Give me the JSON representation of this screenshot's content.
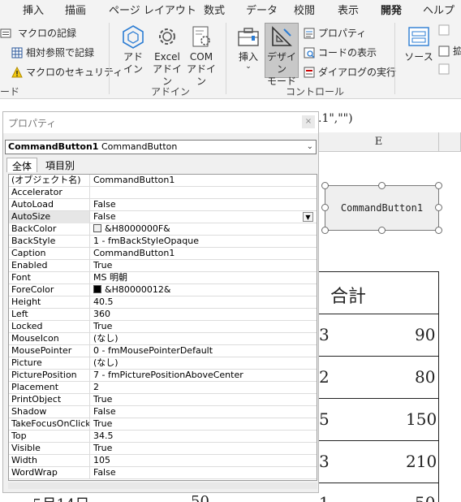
{
  "ribbon": {
    "tabs": [
      {
        "label": "挿入",
        "active": false
      },
      {
        "label": "描画",
        "active": false
      },
      {
        "label": "ページ レイアウト",
        "active": false
      },
      {
        "label": "数式",
        "active": false
      },
      {
        "label": "データ",
        "active": false
      },
      {
        "label": "校閲",
        "active": false
      },
      {
        "label": "表示",
        "active": false
      },
      {
        "label": "開発",
        "active": true
      },
      {
        "label": "ヘルプ",
        "active": false
      }
    ],
    "code_group": {
      "record_macro": "マクロの記録",
      "relative_ref": "相対参照で記録",
      "macro_security": "マクロのセキュリティ",
      "label_partial": "ード"
    },
    "addins_group": {
      "addins": "アド\nイン",
      "excel_addins": "Excel\nアドイン",
      "com_addins": "COM\nアドイン",
      "label": "アドイン"
    },
    "controls_group": {
      "insert": "挿入",
      "design_mode": "デザイン\nモード",
      "properties": "プロパティ",
      "view_code": "コードの表示",
      "run_dialog": "ダイアログの実行",
      "label": "コントロール"
    },
    "xml_group": {
      "source": "ソース",
      "extend_partial": "拡"
    }
  },
  "sheet": {
    "formula_partial": ".1\",\"\")",
    "column_e": "E",
    "header_total": "合計",
    "totals": [
      "90",
      "80",
      "150",
      "210",
      "50"
    ],
    "left_partial_digits": [
      "3",
      "2",
      "5",
      "3",
      "1"
    ],
    "bottom_partial_date": "5月14日",
    "bottom_partial_value": "50",
    "command_button_caption": "CommandButton1"
  },
  "properties": {
    "title": "プロパティ",
    "close": "×",
    "object_name": "CommandButton1",
    "object_type": "CommandButton",
    "tab_all": "全体",
    "tab_category": "項目別",
    "rows": [
      {
        "name": "(オブジェクト名)",
        "value": "CommandButton1"
      },
      {
        "name": "Accelerator",
        "value": ""
      },
      {
        "name": "AutoLoad",
        "value": "False"
      },
      {
        "name": "AutoSize",
        "value": "False"
      },
      {
        "name": "BackColor",
        "value": "&H8000000F&"
      },
      {
        "name": "BackStyle",
        "value": "1 - fmBackStyleOpaque"
      },
      {
        "name": "Caption",
        "value": "CommandButton1"
      },
      {
        "name": "Enabled",
        "value": "True"
      },
      {
        "name": "Font",
        "value": "MS 明朝"
      },
      {
        "name": "ForeColor",
        "value": "&H80000012&"
      },
      {
        "name": "Height",
        "value": "40.5"
      },
      {
        "name": "Left",
        "value": "360"
      },
      {
        "name": "Locked",
        "value": "True"
      },
      {
        "name": "MouseIcon",
        "value": "(なし)"
      },
      {
        "name": "MousePointer",
        "value": "0 - fmMousePointerDefault"
      },
      {
        "name": "Picture",
        "value": "(なし)"
      },
      {
        "name": "PicturePosition",
        "value": "7 - fmPicturePositionAboveCenter"
      },
      {
        "name": "Placement",
        "value": "2"
      },
      {
        "name": "PrintObject",
        "value": "True"
      },
      {
        "name": "Shadow",
        "value": "False"
      },
      {
        "name": "TakeFocusOnClick",
        "value": "True"
      },
      {
        "name": "Top",
        "value": "34.5"
      },
      {
        "name": "Visible",
        "value": "True"
      },
      {
        "name": "Width",
        "value": "105"
      },
      {
        "name": "WordWrap",
        "value": "False"
      }
    ],
    "backcolor_swatch": "#f0f0f0",
    "forecolor_swatch": "#000000"
  },
  "colors": {
    "accent": "#217346",
    "ribbon_bg": "#f3f3f3"
  }
}
